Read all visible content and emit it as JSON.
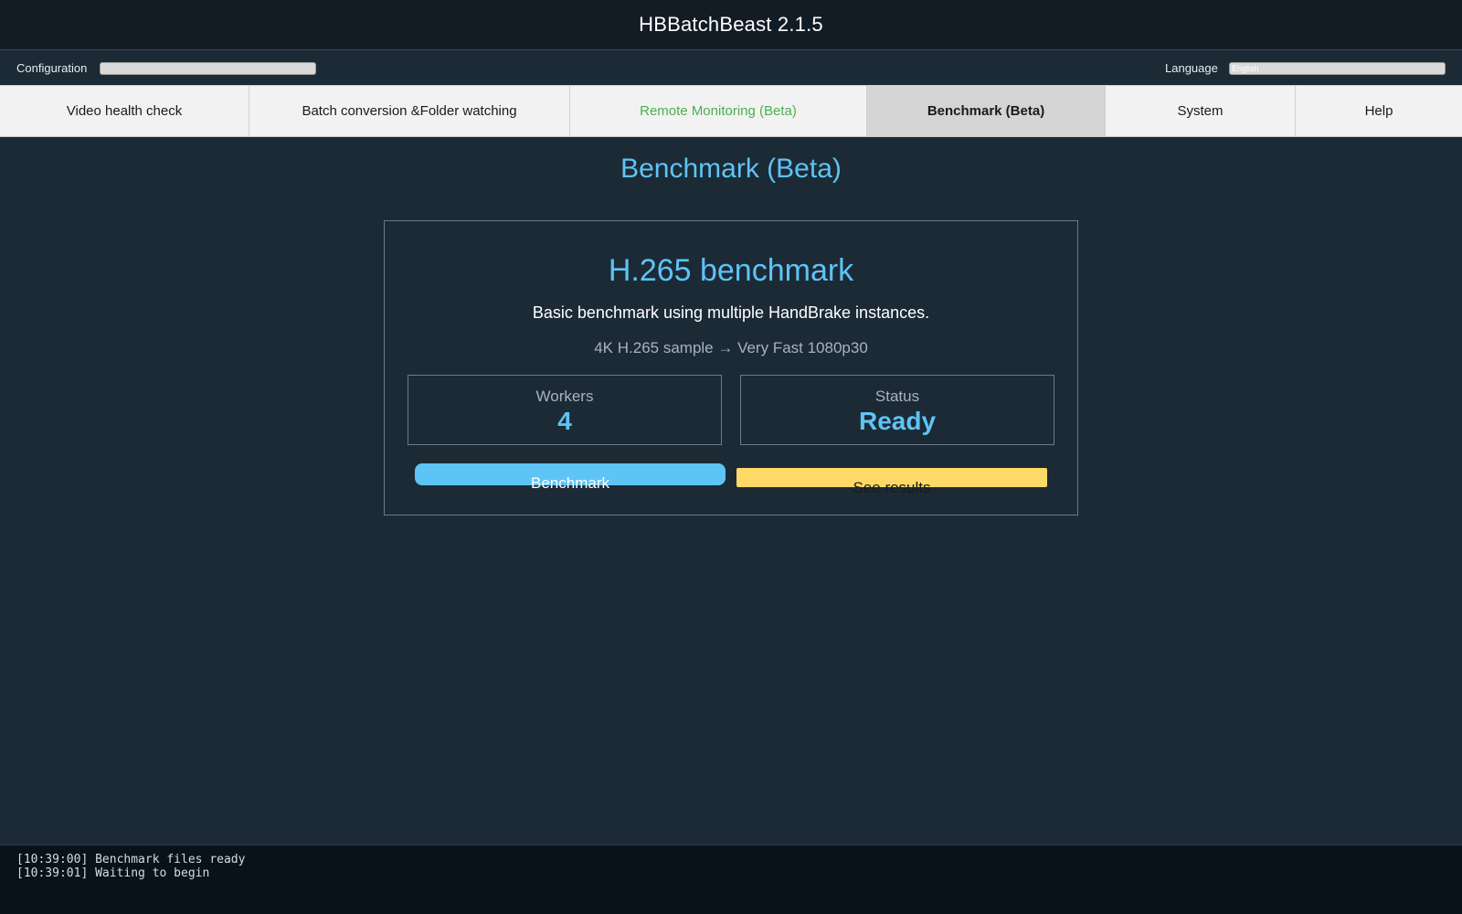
{
  "app": {
    "title": "HBBatchBeast 2.1.5"
  },
  "config": {
    "configuration_label": "Configuration",
    "configuration_value": "",
    "language_label": "Language",
    "language_value": "English"
  },
  "tabs": [
    {
      "label": "Video health check",
      "state": "normal"
    },
    {
      "label": "Batch conversion &Folder watching",
      "state": "normal"
    },
    {
      "label": "Remote Monitoring (Beta)",
      "state": "highlight",
      "color": "#4caf50"
    },
    {
      "label": "Benchmark (Beta)",
      "state": "active"
    },
    {
      "label": "System",
      "state": "normal"
    },
    {
      "label": "Help",
      "state": "normal"
    }
  ],
  "main": {
    "page_title": "Benchmark (Beta)",
    "card": {
      "title": "H.265 benchmark",
      "description": "Basic benchmark using multiple HandBrake instances.",
      "subtitle": "4K H.265 sample → Very Fast 1080p30",
      "workers": {
        "label": "Workers",
        "value": "4"
      },
      "status": {
        "label": "Status",
        "value": "Ready"
      },
      "benchmark_button": "Benchmark",
      "results_button": "See results"
    }
  },
  "log": {
    "lines": [
      "[10:39:00] Benchmark files ready",
      "[10:39:01] Waiting to begin"
    ]
  },
  "colors": {
    "accent": "#5ec4f5",
    "results_button": "#ffd966",
    "background": "#1c2a36"
  }
}
